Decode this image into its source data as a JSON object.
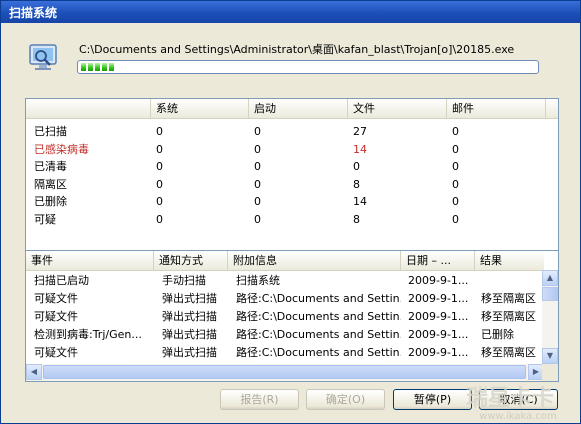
{
  "window": {
    "title": "扫描系统"
  },
  "scan": {
    "path": "C:\\Documents and Settings\\Administrator\\桌面\\kafan_blast\\Trojan[o]\\20185.exe",
    "progress_percent": 8
  },
  "stats": {
    "columns": [
      "",
      "系统",
      "启动",
      "文件",
      "邮件"
    ],
    "rows": [
      {
        "label": "已扫描",
        "system": "0",
        "startup": "0",
        "files": "27",
        "mail": "0",
        "highlight": false
      },
      {
        "label": "已感染病毒",
        "system": "0",
        "startup": "0",
        "files": "14",
        "mail": "0",
        "highlight": true
      },
      {
        "label": "已清毒",
        "system": "0",
        "startup": "0",
        "files": "0",
        "mail": "0",
        "highlight": false
      },
      {
        "label": "隔离区",
        "system": "0",
        "startup": "0",
        "files": "8",
        "mail": "0",
        "highlight": false
      },
      {
        "label": "已删除",
        "system": "0",
        "startup": "0",
        "files": "14",
        "mail": "0",
        "highlight": false
      },
      {
        "label": "可疑",
        "system": "0",
        "startup": "0",
        "files": "8",
        "mail": "0",
        "highlight": false
      }
    ]
  },
  "events": {
    "columns": [
      "事件",
      "通知方式",
      "附加信息",
      "日期 – ...",
      "结果"
    ],
    "rows": [
      {
        "event": "扫描已启动",
        "notify": "手动扫描",
        "info": "扫描系统",
        "date": "2009-9-1...",
        "result": ""
      },
      {
        "event": "可疑文件",
        "notify": "弹出式扫描",
        "info": "路径:C:\\Documents and Settin...",
        "date": "2009-9-1...",
        "result": "移至隔离区"
      },
      {
        "event": "可疑文件",
        "notify": "弹出式扫描",
        "info": "路径:C:\\Documents and Settin...",
        "date": "2009-9-1...",
        "result": "移至隔离区"
      },
      {
        "event": "检测到病毒:Trj/Gen...",
        "notify": "弹出式扫描",
        "info": "路径:C:\\Documents and Settin...",
        "date": "2009-9-1...",
        "result": "已删除"
      },
      {
        "event": "可疑文件",
        "notify": "弹出式扫描",
        "info": "路径:C:\\Documents and Settin...",
        "date": "2009-9-1...",
        "result": "移至隔离区"
      }
    ]
  },
  "buttons": {
    "report": "报告(R)",
    "confirm": "确定(O)",
    "pause": "暂停(P)",
    "cancel": "取消(C)"
  },
  "watermark": {
    "text": "www.ikaka.com",
    "logo_text": "瑞星卡卡"
  },
  "colors": {
    "title_bar": "#2458c6",
    "infected_text": "#c0302a",
    "progress_fill": "#33c21a"
  }
}
